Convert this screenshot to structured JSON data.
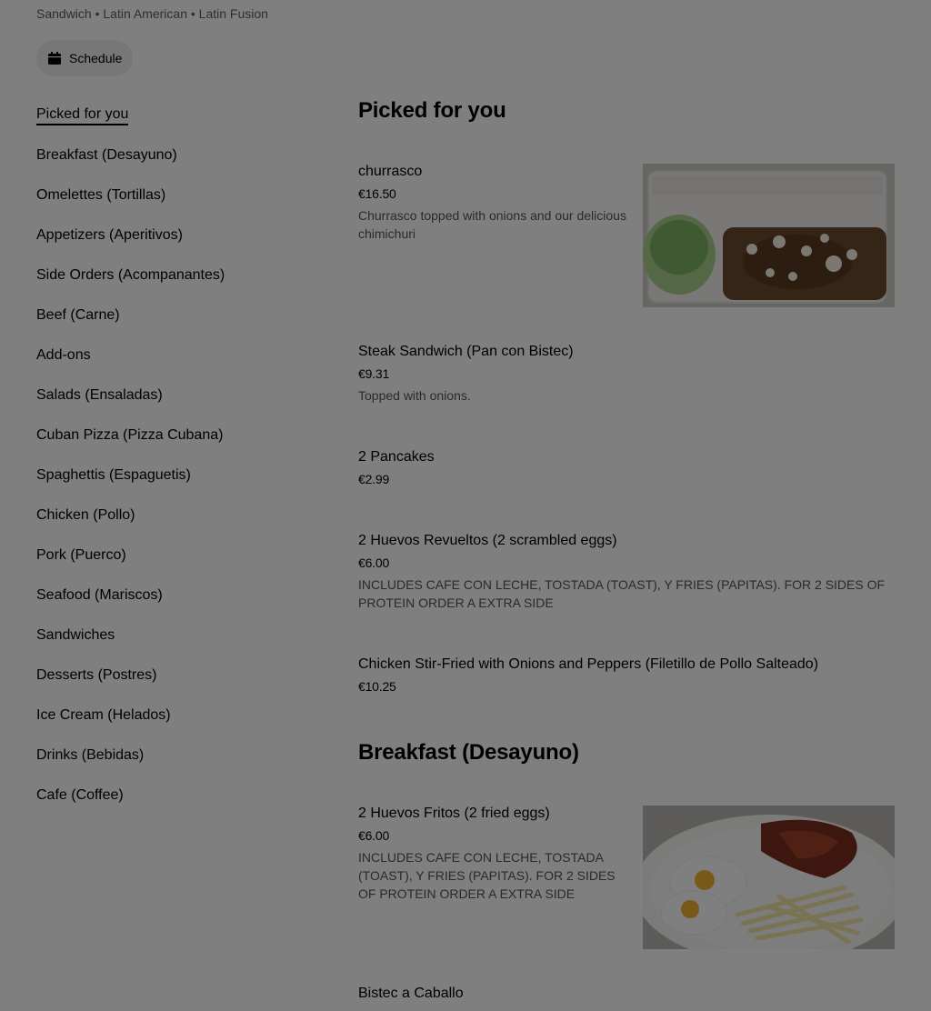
{
  "store": {
    "tags": "Sandwich • Latin American • Latin Fusion",
    "schedule_label": "Schedule"
  },
  "sidebar": {
    "items": [
      {
        "label": "Picked for you"
      },
      {
        "label": "Breakfast (Desayuno)"
      },
      {
        "label": "Omelettes (Tortillas)"
      },
      {
        "label": "Appetizers (Aperitivos)"
      },
      {
        "label": "Side Orders (Acompanantes)"
      },
      {
        "label": "Beef (Carne)"
      },
      {
        "label": "Add-ons"
      },
      {
        "label": "Salads (Ensaladas)"
      },
      {
        "label": "Cuban Pizza (Pizza Cubana)"
      },
      {
        "label": "Spaghettis (Espaguetis)"
      },
      {
        "label": "Chicken (Pollo)"
      },
      {
        "label": "Pork (Puerco)"
      },
      {
        "label": "Seafood (Mariscos)"
      },
      {
        "label": "Sandwiches"
      },
      {
        "label": "Desserts (Postres)"
      },
      {
        "label": "Ice Cream (Helados)"
      },
      {
        "label": "Drinks (Bebidas)"
      },
      {
        "label": "Cafe (Coffee)"
      }
    ]
  },
  "menu": {
    "sections": [
      {
        "title": "Picked for you",
        "items": [
          {
            "name": "churrasco",
            "price": "€16.50",
            "description": "Churrasco topped with onions and our delicious chimichuri",
            "photo": "churrasco-photo"
          },
          {
            "name": "Steak Sandwich (Pan con Bistec)",
            "price": "€9.31",
            "description": "Topped with onions."
          },
          {
            "name": "2 Pancakes",
            "price": "€2.99"
          },
          {
            "name": "2 Huevos Revueltos (2 scrambled eggs)",
            "price": "€6.00",
            "description": "INCLUDES CAFE CON LECHE, TOSTADA (TOAST), Y FRIES (PAPITAS). FOR 2 SIDES OF PROTEIN ORDER A EXTRA SIDE"
          },
          {
            "name": "Chicken Stir-Fried with Onions and Peppers (Filetillo de Pollo Salteado)",
            "price": "€10.25"
          }
        ]
      },
      {
        "title": "Breakfast (Desayuno)",
        "items": [
          {
            "name": "2 Huevos Fritos (2 fried eggs)",
            "price": "€6.00",
            "description": "INCLUDES CAFE CON LECHE, TOSTADA (TOAST), Y FRIES (PAPITAS). FOR 2 SIDES OF PROTEIN ORDER A EXTRA SIDE",
            "photo": "fried-eggs-photo"
          },
          {
            "name": "Bistec a Caballo"
          }
        ]
      }
    ]
  }
}
